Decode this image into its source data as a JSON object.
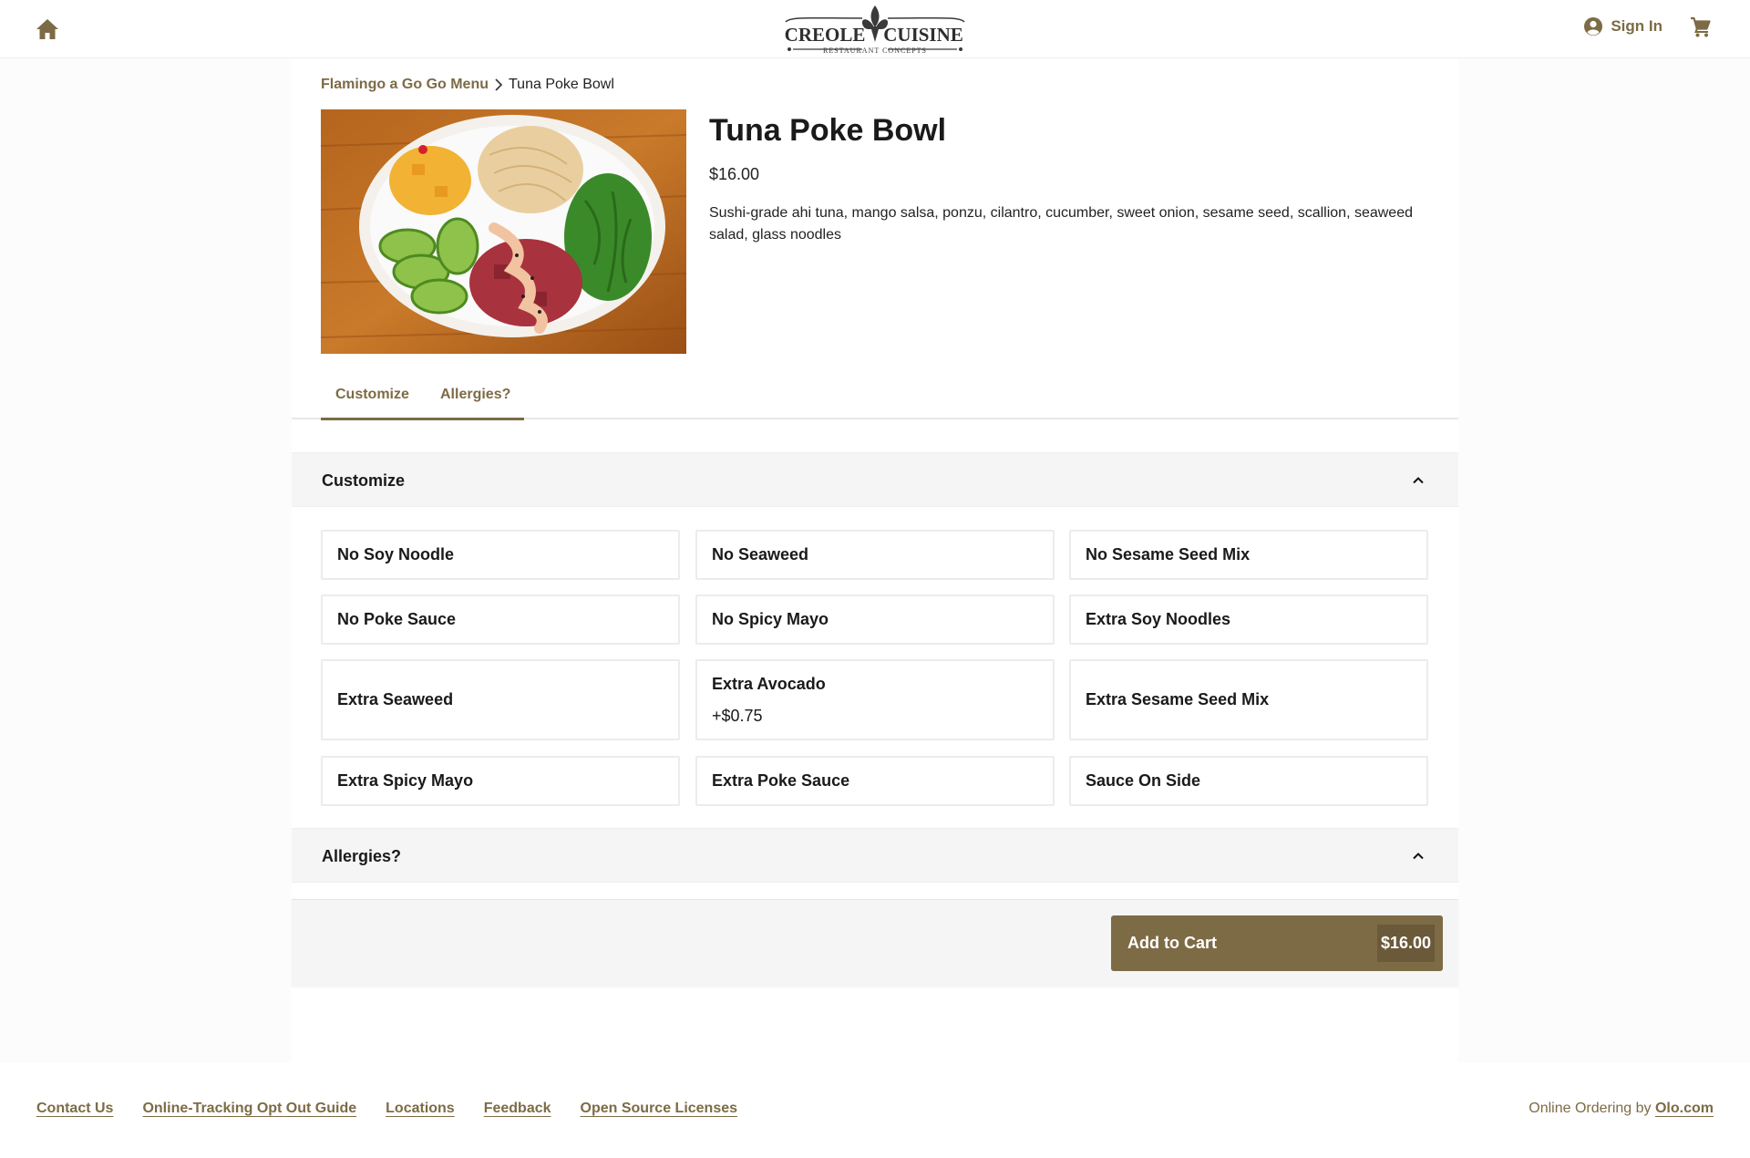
{
  "header": {
    "logo_line1": "CREOLE",
    "logo_line2": "CUISINE",
    "logo_tagline": "RESTAURANT CONCEPTS",
    "signin_label": "Sign In"
  },
  "breadcrumb": {
    "parent": "Flamingo a Go Go Menu",
    "current": "Tuna Poke Bowl"
  },
  "product": {
    "title": "Tuna Poke Bowl",
    "price": "$16.00",
    "description": "Sushi-grade ahi tuna, mango salsa, ponzu, cilantro, cucumber, sweet onion, sesame seed, scallion, seaweed salad, glass noodles"
  },
  "tabs": [
    {
      "label": "Customize"
    },
    {
      "label": "Allergies?"
    }
  ],
  "sections": {
    "customize_title": "Customize",
    "allergies_title": "Allergies?"
  },
  "options": [
    {
      "name": "No Soy Noodle",
      "price": ""
    },
    {
      "name": "No Seaweed",
      "price": ""
    },
    {
      "name": "No Sesame Seed Mix",
      "price": ""
    },
    {
      "name": "No Poke Sauce",
      "price": ""
    },
    {
      "name": "No Spicy Mayo",
      "price": ""
    },
    {
      "name": "Extra Soy Noodles",
      "price": ""
    },
    {
      "name": "Extra Seaweed",
      "price": ""
    },
    {
      "name": "Extra Avocado",
      "price": "+$0.75"
    },
    {
      "name": "Extra Sesame Seed Mix",
      "price": ""
    },
    {
      "name": "Extra Spicy Mayo",
      "price": ""
    },
    {
      "name": "Extra Poke Sauce",
      "price": ""
    },
    {
      "name": "Sauce On Side",
      "price": ""
    }
  ],
  "cart": {
    "add_label": "Add to Cart",
    "total": "$16.00"
  },
  "footer": {
    "links": [
      "Contact Us",
      "Online-Tracking Opt Out Guide",
      "Locations",
      "Feedback",
      "Open Source Licenses"
    ],
    "olo_prefix": "Online Ordering by ",
    "olo_link": "Olo.com"
  },
  "colors": {
    "accent": "#7d6b45",
    "accent_dark": "#6a5a39",
    "section_bg": "#f5f5f5"
  },
  "icons": [
    "home-icon",
    "user-circle-icon",
    "cart-icon",
    "chevron-up-icon",
    "chevron-right-icon"
  ]
}
